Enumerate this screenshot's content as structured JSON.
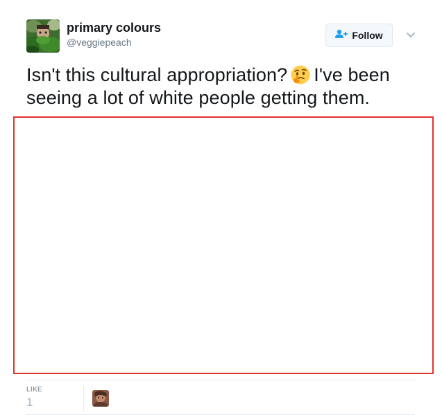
{
  "tweet": {
    "author": {
      "display_name": "primary colours",
      "username": "@veggiepeach"
    },
    "follow_button": {
      "label": "Follow",
      "icon": "add-person-icon"
    },
    "menu_icon": "chevron-down-icon",
    "text_line_1_before_emoji": "Isn't this cultural appropriation?",
    "emoji": "thinking-face-emoji",
    "text_line_1_after_emoji": "I've been",
    "text_line_2": "seeing a lot of white people getting them.",
    "stats": {
      "likes_label": "LIKE",
      "likes_count": "1"
    }
  },
  "colors": {
    "media_border": "#e0332f",
    "follow_icon": "#1da1f2",
    "secondary_text": "#657786"
  }
}
